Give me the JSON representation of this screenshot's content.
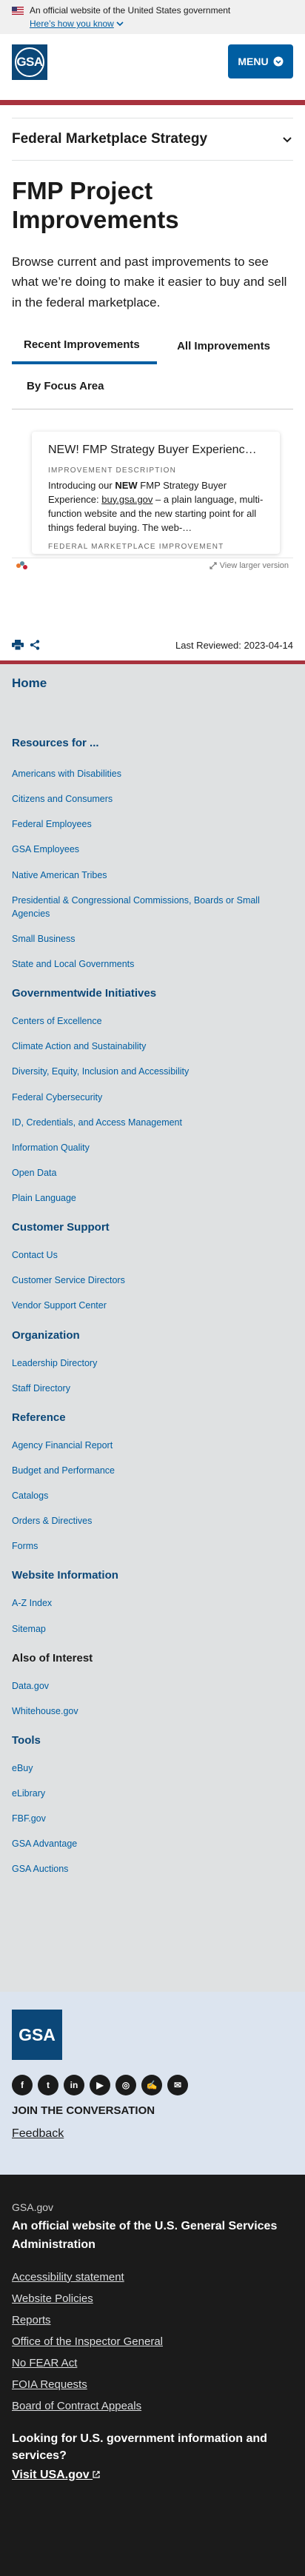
{
  "banner": {
    "official_text": "An official website of the United States government",
    "how_know": "Here’s how you know"
  },
  "header": {
    "logo_text": "GSA",
    "menu_label": "MENU"
  },
  "section_nav": {
    "title": "Federal Marketplace Strategy"
  },
  "page": {
    "title": "FMP Project Improvements",
    "lead": "Browse current and past improvements to see what we’re doing to make it easier to buy and sell in the federal marketplace."
  },
  "tabs": [
    "Recent Improvements",
    "All Improvements",
    "By Focus Area"
  ],
  "embed": {
    "card_title": "NEW! FMP Strategy Buyer Experienc…",
    "desc_label": "IMPROVEMENT DESCRIPTION",
    "desc_pre": "Introducing our ",
    "desc_bold": "NEW",
    "desc_mid": " FMP Strategy Buyer Experience: ",
    "desc_link": "buy.gsa.gov",
    "desc_post": " – a plain language, multi-function website and the new starting point for all things federal buying. The web-…",
    "foot_label": "FEDERAL MARKETPLACE IMPROVEMENT",
    "view_larger": "View larger version"
  },
  "utility": {
    "last_reviewed": "Last Reviewed: 2023-04-14"
  },
  "footer_nav": {
    "home": "Home",
    "resources_heading": "Resources for ...",
    "resources": [
      "Americans with Disabilities",
      "Citizens and Consumers",
      "Federal Employees",
      "GSA Employees",
      "Native American Tribes",
      "Presidential & Congressional Commissions, Boards or Small Agencies",
      "Small Business",
      "State and Local Governments"
    ],
    "gov_heading": "Governmentwide Initiatives",
    "gov": [
      "Centers of Excellence",
      "Climate Action and Sustainability",
      "Diversity, Equity, Inclusion and Accessibility",
      "Federal Cybersecurity",
      "ID, Credentials, and Access Management",
      "Information Quality",
      "Open Data",
      "Plain Language"
    ],
    "cs_heading": "Customer Support",
    "cs": [
      "Contact Us",
      "Customer Service Directors",
      "Vendor Support Center"
    ],
    "org_heading": "Organization",
    "org": [
      "Leadership Directory",
      "Staff Directory"
    ],
    "ref_heading": "Reference",
    "ref": [
      "Agency Financial Report",
      "Budget and Performance",
      "Catalogs",
      "Orders & Directives",
      "Forms"
    ],
    "wi_heading": "Website Information",
    "wi": [
      "A-Z Index",
      "Sitemap"
    ],
    "ai_heading": "Also of Interest",
    "ai": [
      "Data.gov",
      "Whitehouse.gov"
    ],
    "tools_heading": "Tools",
    "tools": [
      "eBuy",
      "eLibrary",
      "FBF.gov",
      "GSA Advantage",
      "GSA Auctions"
    ]
  },
  "footer_brand": {
    "logo_text": "GSA",
    "social": [
      "f",
      "t",
      "in",
      "▶",
      "◎",
      "✍",
      "✉"
    ],
    "join": "JOIN THE CONVERSATION",
    "feedback": "Feedback"
  },
  "identifier": {
    "domain": "GSA.gov",
    "official": "An official website of the U.S. General Services Administration",
    "links": [
      "Accessibility statement",
      "Website Policies",
      "Reports",
      "Office of the Inspector General",
      "No FEAR Act",
      "FOIA Requests",
      "Board of Contract Appeals"
    ],
    "looking": "Looking for U.S. government information and services?",
    "visit": "Visit USA.gov"
  },
  "colors": {
    "brand_red": "#a8323e",
    "brand_blue": "#005ea2",
    "navy": "#0b4778"
  }
}
